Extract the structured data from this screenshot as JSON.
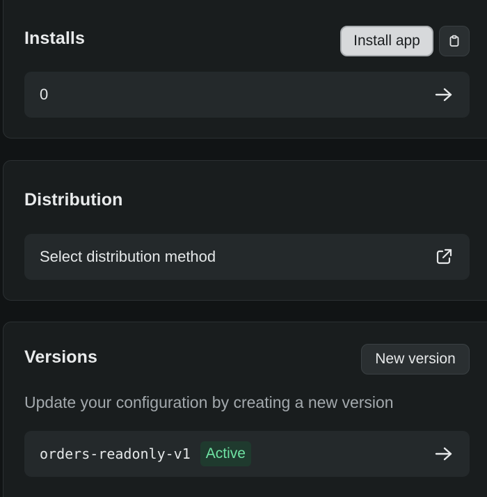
{
  "installs": {
    "title": "Installs",
    "install_button_label": "Install app",
    "clipboard_icon": "clipboard-icon",
    "count": "0",
    "arrow_icon": "arrow-right-icon"
  },
  "distribution": {
    "title": "Distribution",
    "select_label": "Select distribution method",
    "external_icon": "external-link-icon"
  },
  "versions": {
    "title": "Versions",
    "new_version_label": "New version",
    "subtitle": "Update your configuration by creating a new version",
    "version_name": "orders-readonly-v1",
    "status_badge": "Active",
    "arrow_icon": "arrow-right-icon"
  },
  "colors": {
    "background": "#111415",
    "card": "#191d1e",
    "row": "#24292b",
    "badge_bg": "#1f3a2e",
    "badge_text": "#6fe3a3",
    "primary_button": "#d7d9db"
  }
}
